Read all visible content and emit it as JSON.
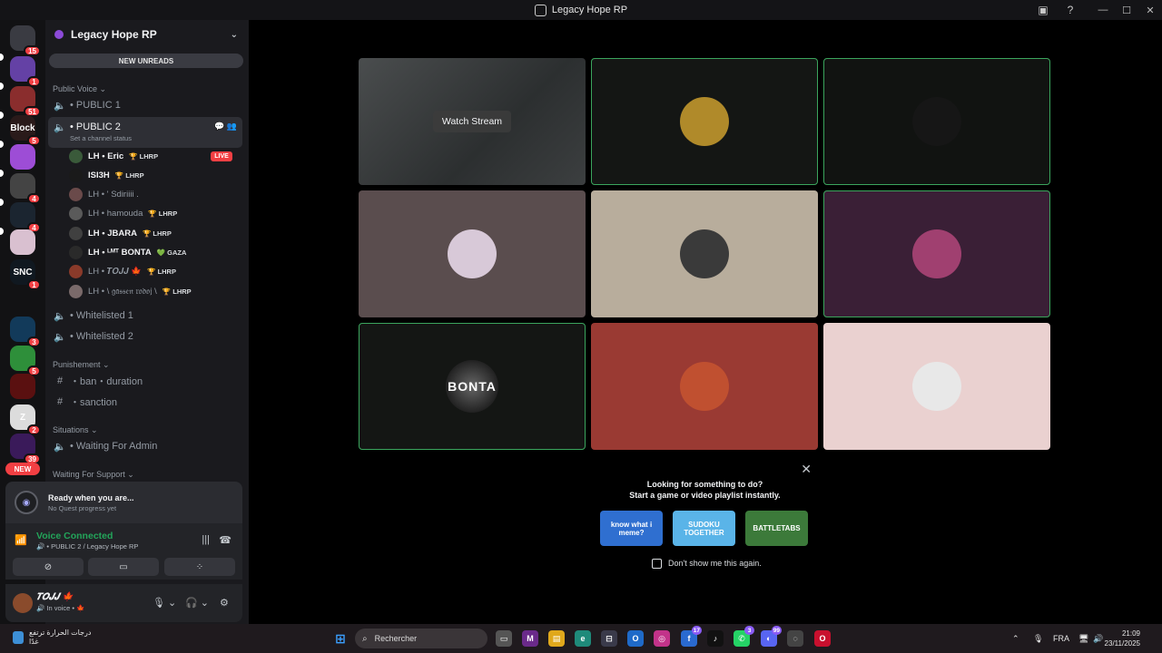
{
  "window": {
    "title": "Legacy Hope RP"
  },
  "rail": {
    "servers": [
      {
        "name": "direct-messages",
        "badge": "15",
        "color": "#3a3b42",
        "label": ""
      },
      {
        "name": "twitch",
        "badge": "1",
        "color": "#6441a5",
        "label": ""
      },
      {
        "name": "server-3",
        "badge": "51",
        "color": "#8a2d2d",
        "label": ""
      },
      {
        "name": "server-4",
        "badge": "5",
        "color": "#2a1a1a",
        "label": "Block"
      },
      {
        "name": "server-5",
        "badge": "",
        "color": "#9d4dd6",
        "label": ""
      },
      {
        "name": "server-6",
        "badge": "4",
        "color": "#444",
        "label": ""
      },
      {
        "name": "server-7",
        "badge": "4",
        "color": "#1b2530",
        "label": ""
      },
      {
        "name": "server-8",
        "badge": "",
        "color": "#d9c0d0",
        "label": ""
      },
      {
        "name": "server-9",
        "badge": "1",
        "color": "#101820",
        "label": "SNC"
      },
      {
        "name": "server-10",
        "badge": "",
        "color": "#121214",
        "label": ""
      },
      {
        "name": "server-11",
        "badge": "3",
        "color": "#123a5a",
        "label": ""
      },
      {
        "name": "server-12",
        "badge": "5",
        "color": "#2e8f3a",
        "label": ""
      },
      {
        "name": "server-13",
        "badge": "",
        "color": "#5a1010",
        "label": ""
      },
      {
        "name": "server-14",
        "badge": "2",
        "color": "#dcdcdc",
        "label": "Z"
      },
      {
        "name": "server-15",
        "badge": "39",
        "color": "#3a1a5a",
        "label": ""
      }
    ],
    "new_label": "NEW"
  },
  "sidebar": {
    "guild_name": "Legacy Hope RP",
    "new_unreads": "NEW UNREADS",
    "categories": {
      "public_voice": "Public Voice",
      "punishement": "Punishement",
      "situations": "Situations",
      "waiting": "Waiting For Support"
    },
    "channels": {
      "public1": "• PUBLIC 1",
      "public2": "• PUBLIC 2",
      "public2_status": "Set a channel status",
      "whitelisted1": "• Whitelisted 1",
      "whitelisted2": "• Whitelisted 2",
      "ban": "・ban・duration",
      "sanction": "・sanction",
      "waiting_admin": "• Waiting For Admin"
    },
    "members": [
      {
        "name": "LH • Eric",
        "tag": "🏆 LHRP",
        "on": true,
        "live": "LIVE",
        "color": "#3a5a3a"
      },
      {
        "name": "ISI3H",
        "tag": "🏆 LHRP",
        "on": true,
        "live": "",
        "color": "#1a1a1a"
      },
      {
        "name": "LH • ' Sdiriiii .",
        "tag": "",
        "on": false,
        "live": "",
        "color": "#6a4a4a"
      },
      {
        "name": "LH • hamouda",
        "tag": "🏆 LHRP",
        "on": false,
        "live": "",
        "color": "#5a5a5a"
      },
      {
        "name": "LH • JBARA",
        "tag": "🏆 LHRP",
        "on": true,
        "live": "",
        "color": "#404040"
      },
      {
        "name": "LH • ᴸᴹᵀ BONTA",
        "tag": "💚 GAZA",
        "on": true,
        "live": "",
        "color": "#2a2a2a"
      },
      {
        "name": "LH • 𝑻𝑶𝑱𝑱 🍁",
        "tag": "🏆 LHRP",
        "on": false,
        "live": "",
        "color": "#8a3a2a"
      },
      {
        "name": "LH • \\ 𝔤𝔞𝔰𝔰𝔢𝔫 𝔯𝔬𝔡𝔬𝔧 \\",
        "tag": "🏆 LHRP",
        "on": false,
        "live": "",
        "color": "#7a6a6a"
      }
    ]
  },
  "quest": {
    "title": "Ready when you are...",
    "subtitle": "No Quest progress yet"
  },
  "voice": {
    "status": "Voice Connected",
    "channel": "🔊 • PUBLIC 2 / Legacy Hope RP"
  },
  "user": {
    "name": "𝑻𝑶𝑱𝑱 🍁",
    "status": "🔊 In voice • 🍁"
  },
  "stage": {
    "watch_stream": "Watch Stream",
    "tiles": [
      {
        "name": "stream-tile",
        "bg": "#3c3f40",
        "speaking": false,
        "kind": "stream"
      },
      {
        "name": "participant-tile-2",
        "bg": "#141614",
        "speaking": true,
        "kind": "avatar",
        "av": "#b08a2a"
      },
      {
        "name": "participant-tile-3",
        "bg": "#111311",
        "speaking": true,
        "kind": "avatar",
        "av": "#161616"
      },
      {
        "name": "participant-tile-4",
        "bg": "#5a4d4e",
        "speaking": false,
        "kind": "avatar",
        "av": "#d8c9d8"
      },
      {
        "name": "participant-tile-5",
        "bg": "#b8ad9c",
        "speaking": false,
        "kind": "avatar",
        "av": "#3a3a3a"
      },
      {
        "name": "participant-tile-6",
        "bg": "#3a1f36",
        "speaking": true,
        "kind": "avatar",
        "av": "#a04070"
      },
      {
        "name": "participant-tile-7",
        "bg": "#141614",
        "speaking": true,
        "kind": "bonta",
        "label": "BONTA"
      },
      {
        "name": "participant-tile-8",
        "bg": "#9a3a33",
        "speaking": false,
        "kind": "avatar",
        "av": "#c05030"
      },
      {
        "name": "participant-tile-9",
        "bg": "#ead1d0",
        "speaking": false,
        "kind": "avatar",
        "av": "#e8e8e8"
      }
    ]
  },
  "activity": {
    "line1": "Looking for something to do?",
    "line2": "Start a game or video playlist instantly.",
    "games": [
      {
        "name": "know what i meme?",
        "color": "#2f6fd0"
      },
      {
        "name": "SUDOKU TOGETHER",
        "color": "#5ab4e8"
      },
      {
        "name": "BATTLETABS",
        "color": "#3c7a3a"
      }
    ],
    "dont_show": "Don't show me this again."
  },
  "taskbar": {
    "weather_line1": "درجات الحرارة ترتفع",
    "weather_line2": "غدًا",
    "search_placeholder": "Rechercher",
    "lang": "FRA",
    "time": "21:09",
    "date": "23/11/2025"
  }
}
